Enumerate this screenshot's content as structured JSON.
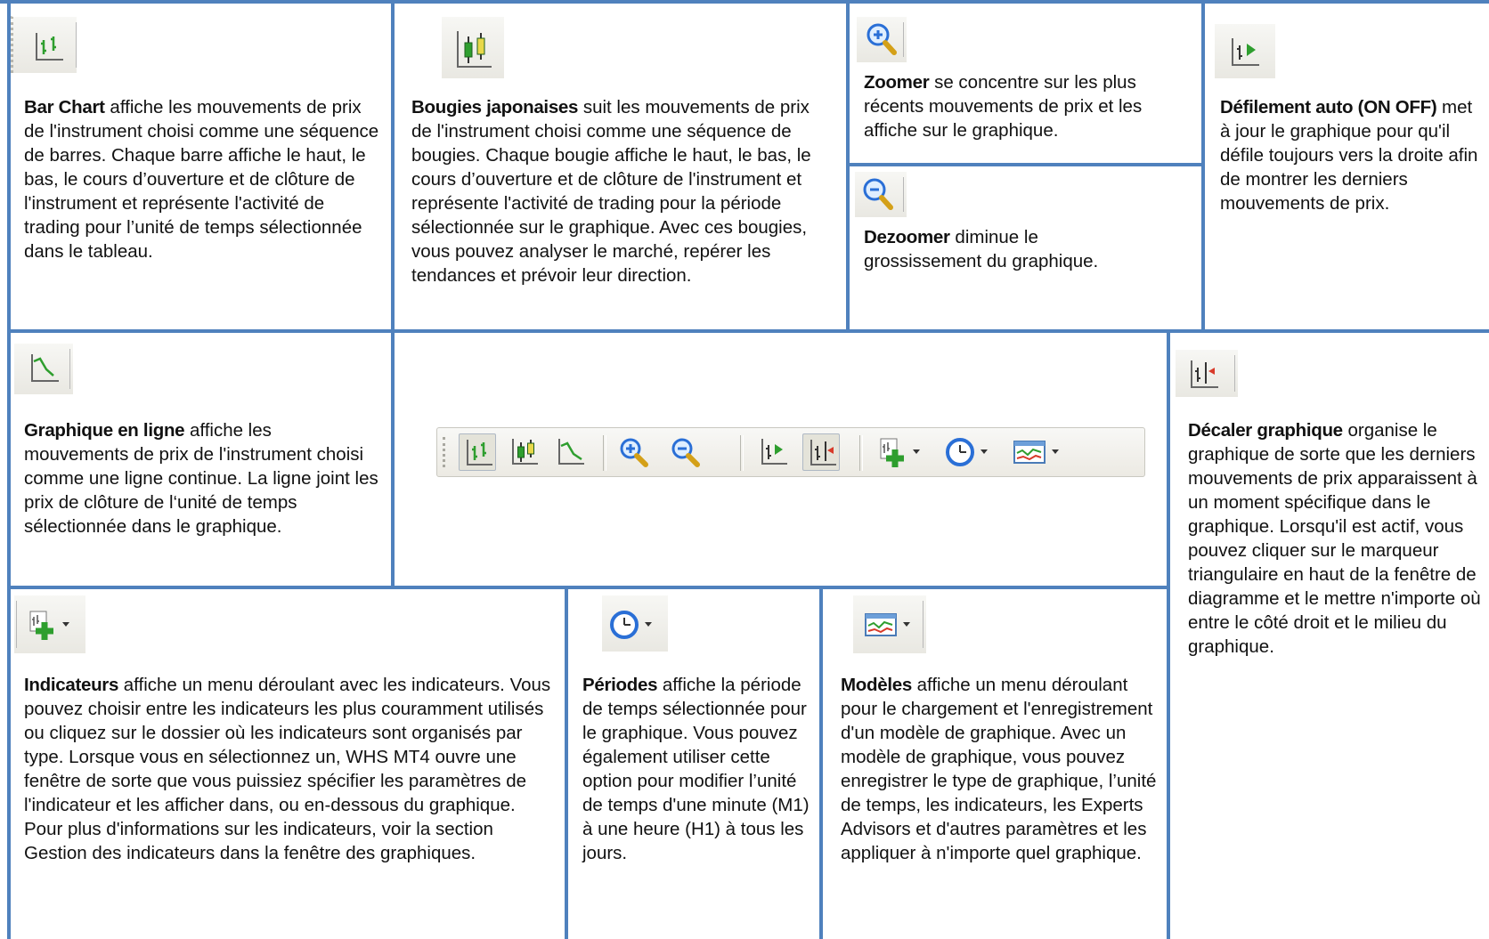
{
  "bar_chart": {
    "title": "Bar Chart",
    "text": " affiche les mouvements de prix de l'instrument choisi comme une séquence de barres. Chaque barre affiche le haut, le bas, le cours d’ouverture et de clôture de l'instrument et représente l'activité de trading pour l’unité de temps sélectionnée dans le tableau."
  },
  "candles": {
    "title": "Bougies japonaises",
    "text": " suit les mouvements de prix de l'instrument choisi comme une séquence de bougies. Chaque bougie affiche le haut, le bas, le cours d’ouverture et de clôture de l'instrument et représente l'activité de trading pour la période sélectionnée sur le graphique. Avec ces bougies, vous pouvez analyser le marché, repérer les tendances et prévoir leur direction."
  },
  "zoom_in": {
    "title": "Zoomer",
    "text": " se concentre sur les plus récents mouvements de prix et les affiche sur le graphique."
  },
  "zoom_out": {
    "title": "Dezoomer",
    "text": " diminue le grossissement du graphique."
  },
  "autoscroll": {
    "title": "Défilement auto (ON OFF)",
    "text": " met à jour le graphique pour qu'il défile toujours vers la droite afin de montrer les derniers mouvements de prix."
  },
  "line_chart": {
    "title": "Graphique en ligne",
    "text": " affiche les mouvements de prix de l'instrument choisi comme une ligne continue. La ligne joint les prix de clôture de l‘unité de temps sélectionnée dans le graphique."
  },
  "chart_shift": {
    "title": "Décaler graphique",
    "text": " organise le graphique de sorte que les derniers mouvements de prix apparaissent à un moment spécifique dans le graphique. Lorsqu'il est actif, vous pouvez cliquer sur le marqueur triangulaire en haut de la fenêtre de diagramme et le mettre n'importe où entre le côté droit et le milieu du graphique."
  },
  "indicators": {
    "title": "Indicateurs",
    "text": " affiche un menu déroulant avec les indicateurs. Vous pouvez choisir entre les indicateurs les plus couramment utilisés ou cliquez sur le dossier où les indicateurs sont organisés par type. Lorsque vous en sélectionnez un, WHS MT4 ouvre une fenêtre de sorte que vous puissiez spécifier les paramètres de l'indicateur et les afficher dans, ou en-dessous du graphique. Pour plus d'informations sur les indicateurs, voir la section Gestion des indicateurs dans la fenêtre des graphiques."
  },
  "periods": {
    "title": "Périodes",
    "text": " affiche la période de temps sélectionnée pour le graphique. Vous pouvez également utiliser cette option pour modifier l’unité de temps d'une minute (M1) à une heure (H1) à tous les jours."
  },
  "templates": {
    "title": "Modèles",
    "text": " affiche un menu déroulant pour le chargement et l'enregistrement d'un modèle de graphique. Avec un modèle de graphique, vous pouvez enregistrer le type de graphique, l’unité de temps, les indicateurs, les Experts Advisors et d'autres paramètres et les appliquer à n'importe quel graphique."
  },
  "icons": {
    "bar_chart": "bar-chart-icon",
    "candles": "candlestick-icon",
    "line_chart": "line-chart-icon",
    "zoom_in": "zoom-in-icon",
    "zoom_out": "zoom-out-icon",
    "autoscroll": "autoscroll-icon",
    "chart_shift": "chart-shift-icon",
    "indicators": "indicators-icon",
    "periods": "periods-clock-icon",
    "templates": "templates-icon"
  },
  "colors": {
    "grid": "#4f81bd",
    "toolbar_bg": "#eceae3",
    "icon_green": "#2e9e2e",
    "icon_blue": "#2a6fd6"
  }
}
